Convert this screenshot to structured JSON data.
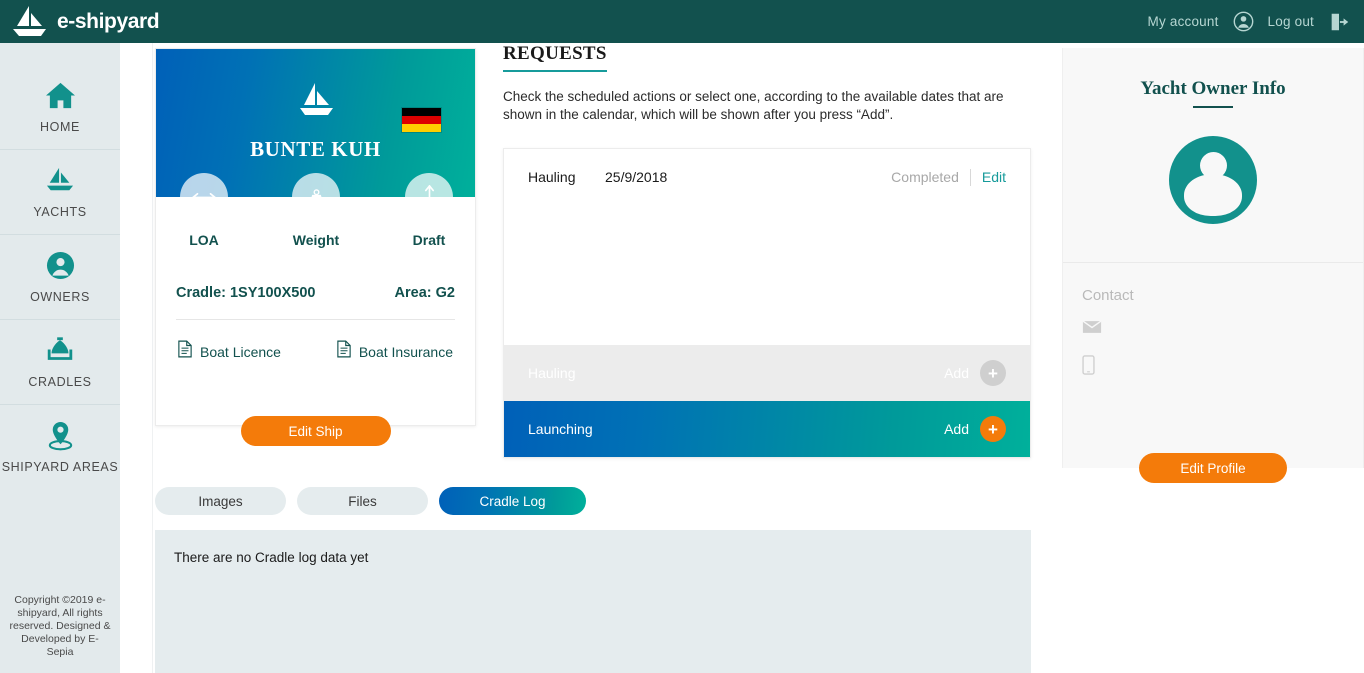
{
  "topbar": {
    "brand": "e-shipyard",
    "logo_icon": "sailboat-icon",
    "account_label": "My account",
    "account_icon": "user-circle-icon",
    "logout_label": "Log out",
    "logout_icon": "logout-icon"
  },
  "sidebar": {
    "items": [
      {
        "label": "HOME",
        "icon": "home-icon"
      },
      {
        "label": "YACHTS",
        "icon": "sailboat-icon"
      },
      {
        "label": "OWNERS",
        "icon": "user-circle-icon"
      },
      {
        "label": "CRADLES",
        "icon": "cradle-boat-icon"
      },
      {
        "label": "SHIPYARD AREAS",
        "icon": "map-pin-icon"
      }
    ],
    "copyright": "Copyright ©2019 e-shipyard, All rights reserved. Designed & Developed by E-Sepia"
  },
  "yacht_card": {
    "name": "BUNTE KUH",
    "boat_icon": "sailboat-icon",
    "flag": "germany-flag",
    "stats": [
      {
        "label": "LOA",
        "icon": "horizontal-arrow-icon",
        "value": ""
      },
      {
        "label": "Weight",
        "icon": "weight-icon",
        "value": ""
      },
      {
        "label": "Draft",
        "icon": "vertical-arrow-icon",
        "value": ""
      }
    ],
    "cradle": "Cradle: 1SY100X500",
    "area": "Area: G2",
    "documents": [
      {
        "label": "Boat Licence",
        "icon": "document-icon"
      },
      {
        "label": "Boat Insurance",
        "icon": "document-icon"
      }
    ],
    "edit_button": "Edit Ship"
  },
  "requests": {
    "title": "REQUESTS",
    "description": "Check the scheduled actions or select one, according to the available dates that are shown in the calendar, which will be shown after you press “Add”.",
    "scheduled": [
      {
        "name": "Hauling",
        "date": "25/9/2018",
        "status": "Completed",
        "edit_label": "Edit"
      }
    ],
    "actions": [
      {
        "name": "Hauling",
        "add_label": "Add",
        "state": "disabled"
      },
      {
        "name": "Launching",
        "add_label": "Add",
        "state": "active"
      }
    ]
  },
  "owner": {
    "title": "Yacht Owner Info",
    "avatar_icon": "user-avatar-icon",
    "contact_label": "Contact",
    "email_icon": "envelope-icon",
    "email_value": "",
    "phone_icon": "mobile-phone-icon",
    "phone_value": "",
    "edit_button": "Edit Profile"
  },
  "tabs": {
    "items": [
      {
        "label": "Images",
        "active": false
      },
      {
        "label": "Files",
        "active": false
      },
      {
        "label": "Cradle Log",
        "active": true
      }
    ],
    "empty_message": "There are no Cradle log data yet"
  },
  "colors": {
    "brand_dark": "#12514e",
    "teal": "#179b9b",
    "orange": "#f47b0a",
    "gradient_start": "#0060b8",
    "gradient_end": "#00b09b",
    "sidebar_bg": "#e3eaec"
  }
}
